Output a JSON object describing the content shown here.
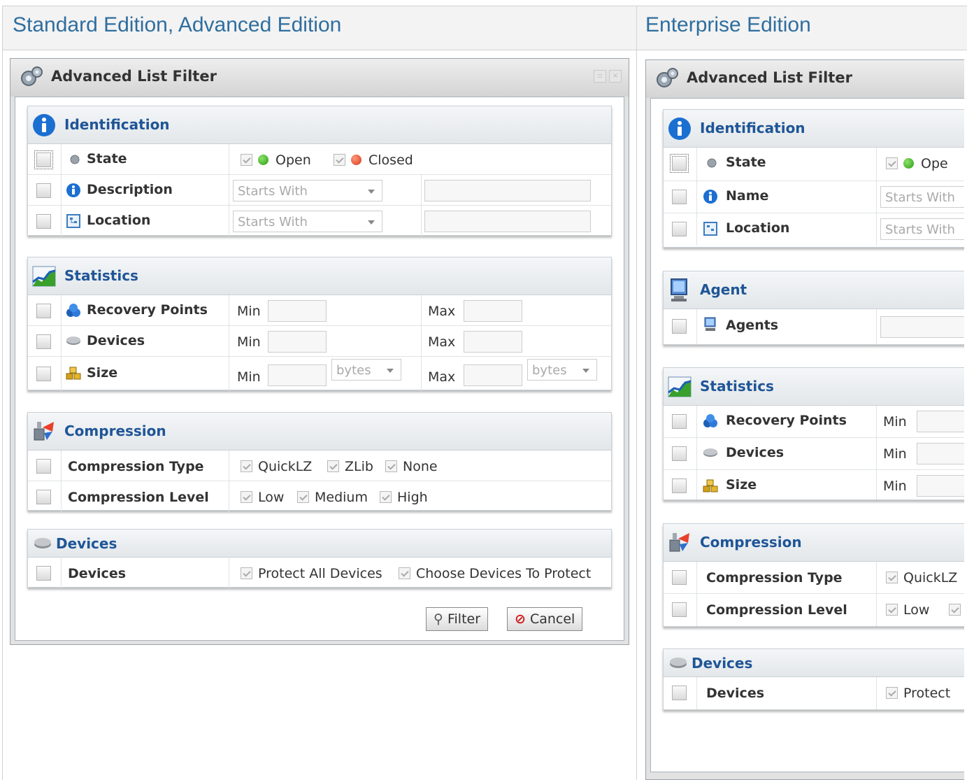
{
  "columns": {
    "left_title": "Standard Edition, Advanced Edition",
    "right_title": "Enterprise Edition"
  },
  "window": {
    "title": "Advanced List Filter"
  },
  "left": {
    "identification": {
      "title": "Identification",
      "state_label": "State",
      "open": "Open",
      "closed": "Closed",
      "description_label": "Description",
      "location_label": "Location",
      "match_placeholder": "Starts With"
    },
    "statistics": {
      "title": "Statistics",
      "recovery_points": "Recovery Points",
      "devices": "Devices",
      "size": "Size",
      "min": "Min",
      "max": "Max",
      "unit": "bytes"
    },
    "compression": {
      "title": "Compression",
      "type_label": "Compression Type",
      "level_label": "Compression Level",
      "quicklz": "QuickLZ",
      "zlib": "ZLib",
      "none": "None",
      "low": "Low",
      "medium": "Medium",
      "high": "High"
    },
    "devices": {
      "title": "Devices",
      "label": "Devices",
      "protect_all": "Protect All Devices",
      "choose": "Choose Devices To Protect"
    },
    "buttons": {
      "filter": "Filter",
      "cancel": "Cancel"
    }
  },
  "right": {
    "identification": {
      "title": "Identification",
      "state_label": "State",
      "open": "Ope",
      "name_label": "Name",
      "location_label": "Location",
      "match_placeholder": "Starts With"
    },
    "agent": {
      "title": "Agent",
      "agents_label": "Agents"
    },
    "statistics": {
      "title": "Statistics",
      "recovery_points": "Recovery Points",
      "devices": "Devices",
      "size": "Size",
      "min": "Min"
    },
    "compression": {
      "title": "Compression",
      "type_label": "Compression Type",
      "level_label": "Compression Level",
      "quicklz": "QuickLZ",
      "low": "Low"
    },
    "devices": {
      "title": "Devices",
      "label": "Devices",
      "protect": "Protect"
    }
  }
}
